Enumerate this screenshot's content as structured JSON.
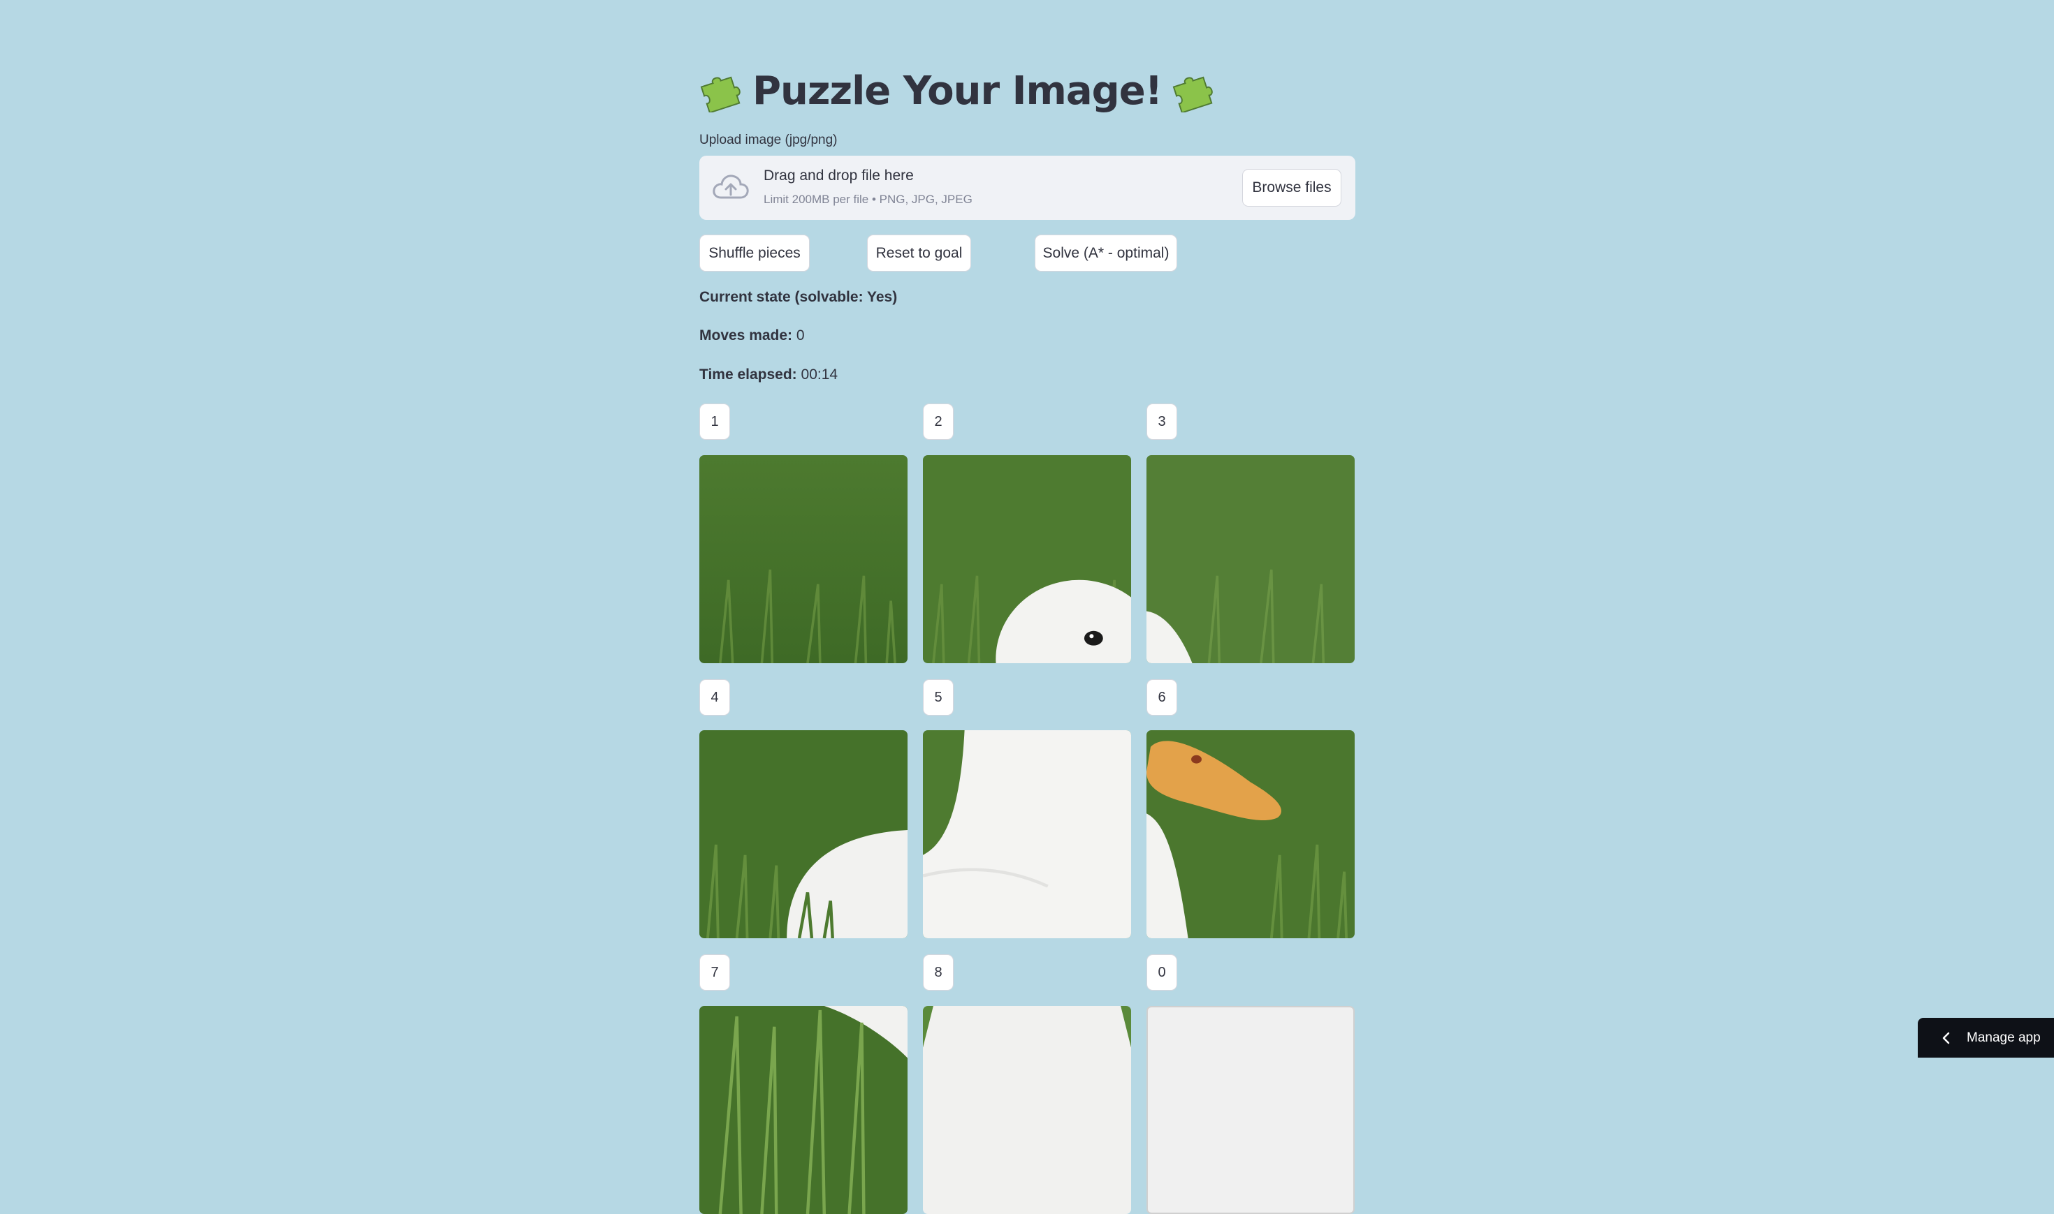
{
  "title": "Puzzle Your Image!",
  "title_icon": "puzzle-piece-icon",
  "uploader": {
    "label": "Upload image (jpg/png)",
    "drop_text": "Drag and drop file here",
    "limit_text": "Limit 200MB per file • PNG, JPG, JPEG",
    "browse_label": "Browse files"
  },
  "actions": {
    "shuffle": "Shuffle pieces",
    "reset": "Reset to goal",
    "solve": "Solve (A* - optimal)"
  },
  "status": {
    "state_label": "Current state (solvable: Yes)",
    "moves_label": "Moves made:",
    "moves_value": "0",
    "time_label": "Time elapsed:",
    "time_value": "00:14"
  },
  "tiles": [
    {
      "label": "1",
      "piece": "grass"
    },
    {
      "label": "2",
      "piece": "duck-head-eye"
    },
    {
      "label": "3",
      "piece": "grass-with-duck-edge"
    },
    {
      "label": "4",
      "piece": "duck-back-in-grass"
    },
    {
      "label": "5",
      "piece": "duck-neck"
    },
    {
      "label": "6",
      "piece": "duck-beak"
    },
    {
      "label": "7",
      "piece": "grass-blades"
    },
    {
      "label": "8",
      "piece": "duck-body"
    },
    {
      "label": "0",
      "piece": "empty"
    }
  ],
  "manage_app": "Manage app",
  "colors": {
    "background": "#b6d8e4",
    "grass": "#4f7a32",
    "duck": "#f5f5f3",
    "beak": "#e3a24a"
  }
}
